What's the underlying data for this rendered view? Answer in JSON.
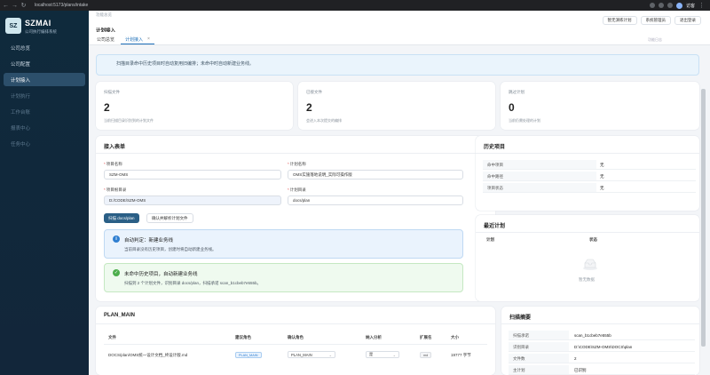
{
  "browser": {
    "url": "localhost:5173/plans/intake",
    "profile_name": "访客"
  },
  "sidebar": {
    "logo": "SZ",
    "brand": "SZMAI",
    "brand_sub": "公司执行编排系统",
    "items": [
      {
        "label": "公司总览"
      },
      {
        "label": "公司配置"
      },
      {
        "label": "计划接入"
      },
      {
        "label": "计划执行"
      },
      {
        "label": "工作台账"
      },
      {
        "label": "报表中心"
      },
      {
        "label": "任务中心"
      }
    ]
  },
  "topbar": {
    "breadcrumb": "功能总览",
    "buttons": [
      "暂无演练计划",
      "系统管理员",
      "退出登录"
    ]
  },
  "tabs": [
    {
      "label": "公司总览"
    },
    {
      "label": "计划接入"
    }
  ],
  "page": {
    "section_title": "计划接入",
    "side_fragment": "计划接入",
    "right_fragment": "功能日志"
  },
  "banner": {
    "text": "扫描目录命中历史项目时自动复用旧编排；未命中时自动新建业务线。"
  },
  "stats": [
    {
      "label": "扫描文件",
      "value": "2",
      "desc": "当前扫描目录识别到的计划文件"
    },
    {
      "label": "已接文件",
      "value": "2",
      "desc": "会进入本次提交的编排"
    },
    {
      "label": "跳过计划",
      "value": "0",
      "desc": "当前仍需处理的计划"
    }
  ],
  "intake_form": {
    "title": "接入表单",
    "project_name_label": "项目名称",
    "project_name_value": "SZM-OMS",
    "plan_name_label": "计划名称",
    "plan_name_value": "OMS实施落地说明_实际可操作版",
    "project_root_label": "项目根目录",
    "project_root_value": "D:/CODE/SZM-OMS",
    "plan_dir_label": "计划目录",
    "plan_dir_value": "docs/plan",
    "scan_button": "扫描 docs/plan",
    "confirm_button": "确认并解析计划文件"
  },
  "auto_judgement": {
    "title": "自动判定：新建业务线",
    "text": "当前目录没有历史项目，创建时将自动新建业务线。"
  },
  "scan_result": {
    "title": "未命中历史项目，自动新建业务线",
    "text": "扫描到 2 个计划文件，识别目录 docs/plan，扫描承诺 scan_b1cbeb7e555b。"
  },
  "history": {
    "title": "历史项目",
    "rows": [
      {
        "k": "命中项目",
        "v": "无"
      },
      {
        "k": "命中路径",
        "v": "无"
      },
      {
        "k": "项目状态",
        "v": "无"
      }
    ]
  },
  "recent_plans": {
    "title": "最近计划",
    "columns": [
      "计划",
      "状态"
    ],
    "empty": "暂无数据"
  },
  "plan_main": {
    "title": "PLAN_MAIN",
    "columns": [
      "文件",
      "建议角色",
      "确认角色",
      "纳入分析",
      "扩展名",
      "大小"
    ],
    "rows": [
      {
        "file": "DOCS/plan/OMS统一设计文档_终设计版.md",
        "suggest": "PLAN_MAIN",
        "confirm": "PLAN_MAIN",
        "include": "是",
        "ext": "md",
        "size": "19777 字节"
      }
    ]
  },
  "scan_summary": {
    "title": "扫描摘要",
    "rows": [
      {
        "k": "扫描承诺",
        "v": "scan_b1cbeb7e555b"
      },
      {
        "k": "识别目录",
        "v": "D:\\CODE\\SZM-OMS\\DOCS\\plan"
      },
      {
        "k": "文件数",
        "v": "2"
      },
      {
        "k": "主计划",
        "v": "已识别"
      }
    ]
  }
}
